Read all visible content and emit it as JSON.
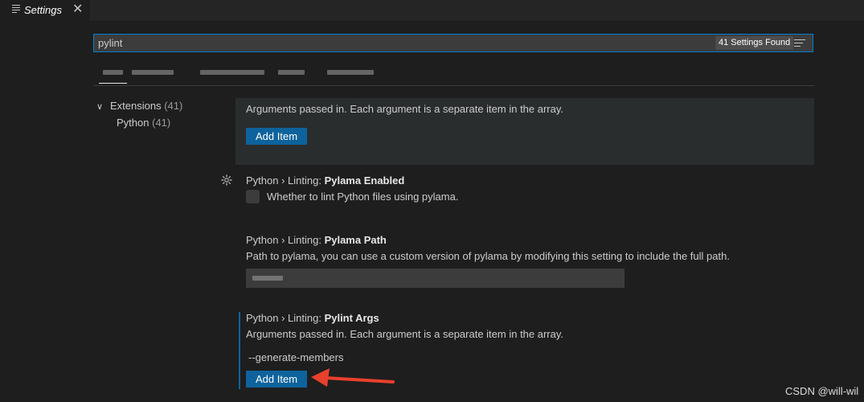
{
  "tab": {
    "title": "Settings"
  },
  "search": {
    "value": "pylint",
    "found": "41 Settings Found"
  },
  "toc": {
    "extensions_label": "Extensions",
    "extensions_count": "(41)",
    "python_label": "Python",
    "python_count": "(41)"
  },
  "settings": [
    {
      "description": "Arguments passed in. Each argument is a separate item in the array.",
      "button": "Add Item"
    },
    {
      "category": "Python › Linting: ",
      "name": "Pylama Enabled",
      "description": "Whether to lint Python files using pylama."
    },
    {
      "category": "Python › Linting: ",
      "name": "Pylama Path",
      "description": "Path to pylama, you can use a custom version of pylama by modifying this setting to include the full path."
    },
    {
      "category": "Python › Linting: ",
      "name": "Pylint Args",
      "description": "Arguments passed in. Each argument is a separate item in the array.",
      "items": [
        "--generate-members"
      ],
      "button": "Add Item"
    }
  ],
  "watermark": "CSDN @will-wil",
  "colors": {
    "accent": "#0e639c",
    "focus_border": "#007fd4",
    "arrow": "#e8402c"
  }
}
